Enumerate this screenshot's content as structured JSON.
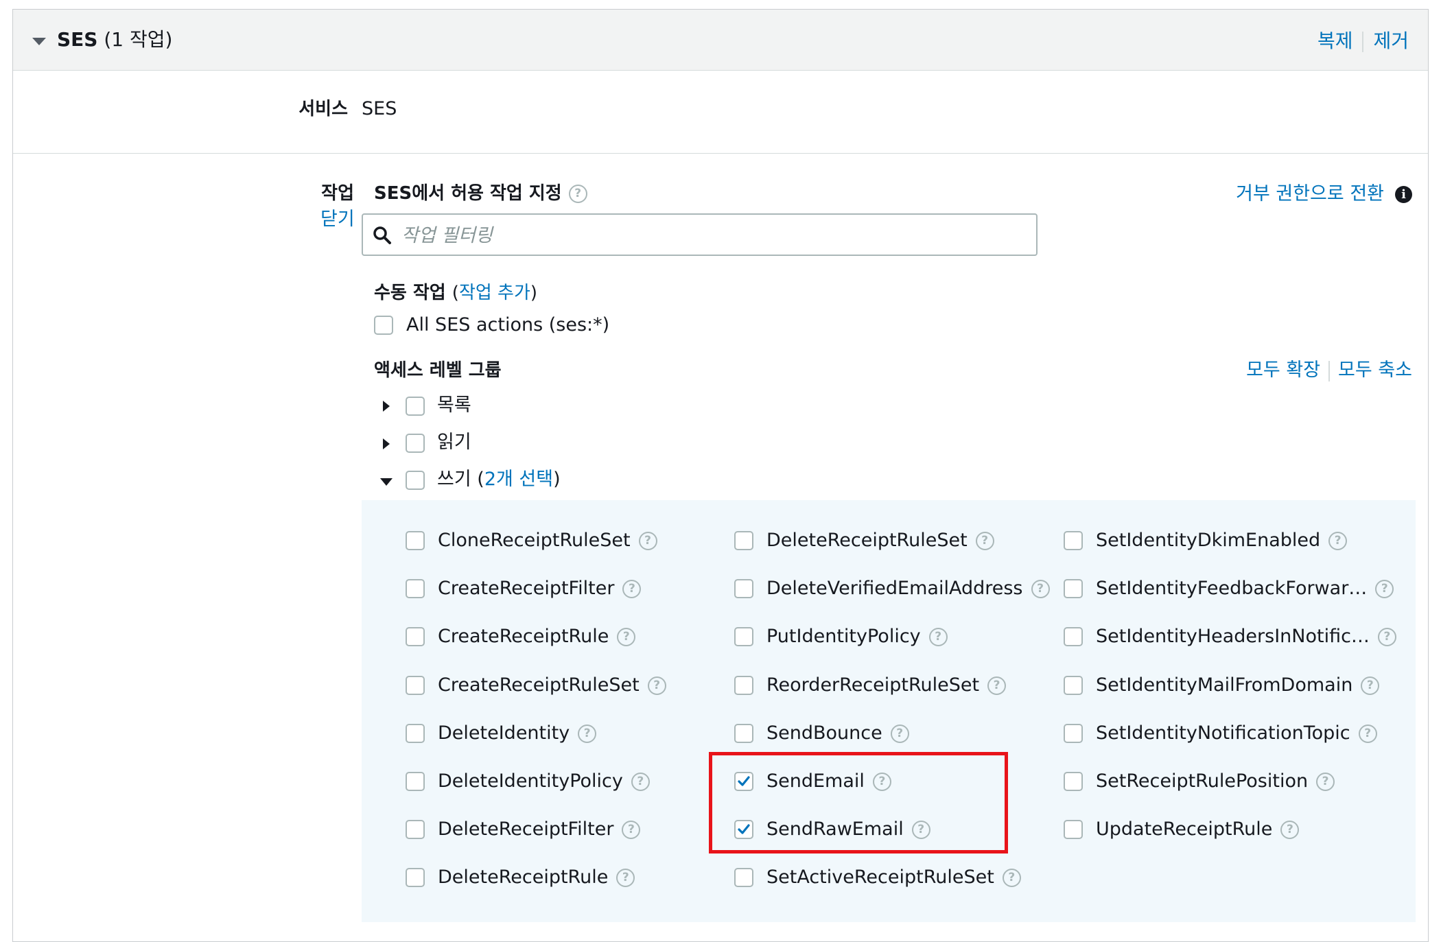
{
  "header": {
    "service_name": "SES",
    "count_label": "(1 작업)",
    "duplicate_link": "복제",
    "remove_link": "제거"
  },
  "service_row": {
    "label": "서비스",
    "value": "SES"
  },
  "actions_row": {
    "label": "작업",
    "close_link": "닫기",
    "heading": "SES에서 허용 작업 지정",
    "switch_link": "거부 권한으로 전환",
    "search_placeholder": "작업 필터링",
    "manual_label": "수동 작업",
    "manual_open": "(",
    "manual_link": "작업 추가",
    "manual_close": ")",
    "all_actions_label": "All SES actions (ses:*)",
    "access_level_label": "액세스 레벨 그룹",
    "expand_all": "모두 확장",
    "collapse_all": "모두 축소",
    "groups": [
      {
        "label": "목록",
        "expanded": false
      },
      {
        "label": "읽기",
        "expanded": false
      },
      {
        "label": "쓰기",
        "expanded": true,
        "selected_prefix": "(",
        "selected_link": "2개 선택",
        "selected_suffix": ")"
      }
    ],
    "write_actions": {
      "col1": [
        {
          "label": "CloneReceiptRuleSet",
          "checked": false
        },
        {
          "label": "CreateReceiptFilter",
          "checked": false
        },
        {
          "label": "CreateReceiptRule",
          "checked": false
        },
        {
          "label": "CreateReceiptRuleSet",
          "checked": false
        },
        {
          "label": "DeleteIdentity",
          "checked": false
        },
        {
          "label": "DeleteIdentityPolicy",
          "checked": false
        },
        {
          "label": "DeleteReceiptFilter",
          "checked": false
        },
        {
          "label": "DeleteReceiptRule",
          "checked": false
        }
      ],
      "col2": [
        {
          "label": "DeleteReceiptRuleSet",
          "checked": false
        },
        {
          "label": "DeleteVerifiedEmailAddress",
          "checked": false
        },
        {
          "label": "PutIdentityPolicy",
          "checked": false
        },
        {
          "label": "ReorderReceiptRuleSet",
          "checked": false
        },
        {
          "label": "SendBounce",
          "checked": false
        },
        {
          "label": "SendEmail",
          "checked": true
        },
        {
          "label": "SendRawEmail",
          "checked": true
        },
        {
          "label": "SetActiveReceiptRuleSet",
          "checked": false
        }
      ],
      "col3": [
        {
          "label": "SetIdentityDkimEnabled",
          "checked": false
        },
        {
          "label": "SetIdentityFeedbackForwar…",
          "checked": false
        },
        {
          "label": "SetIdentityHeadersInNotific…",
          "checked": false
        },
        {
          "label": "SetIdentityMailFromDomain",
          "checked": false
        },
        {
          "label": "SetIdentityNotificationTopic",
          "checked": false
        },
        {
          "label": "SetReceiptRulePosition",
          "checked": false
        },
        {
          "label": "UpdateReceiptRule",
          "checked": false
        }
      ]
    }
  },
  "colors": {
    "link": "#0073bb",
    "header_bg": "#f2f3f3",
    "write_bg": "#f1f8fc",
    "highlight": "#e8141a",
    "check": "#0073bb"
  },
  "icons": {
    "collapse_caret": "caret-down-icon",
    "help": "question-circle-icon",
    "info": "info-icon",
    "search": "search-icon",
    "expand": "caret-right-icon",
    "check": "checkmark-icon"
  }
}
